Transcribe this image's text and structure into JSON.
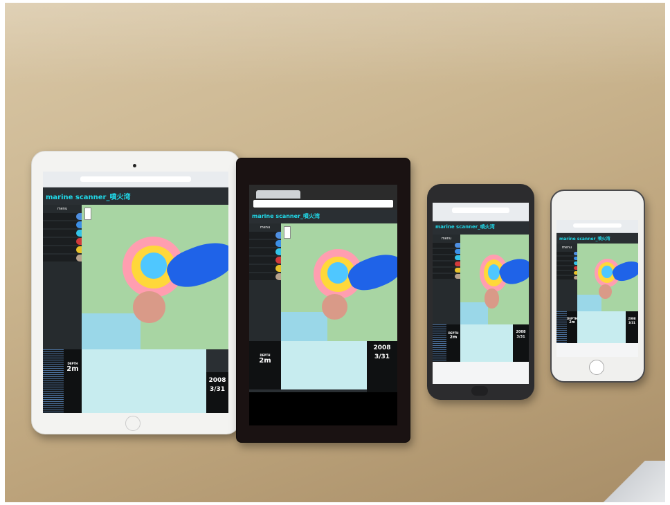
{
  "scene": {
    "description_colors": {
      "table": "#c8b38e",
      "app_accent": "#20d8e8"
    }
  },
  "app": {
    "title": "marine scanner_噴火湾",
    "sidebar_header": "menu",
    "layers": [
      {
        "label": "",
        "color": "#4f8fe0"
      },
      {
        "label": "",
        "color": "#3c8fe6"
      },
      {
        "label": "",
        "color": "#34c3e8"
      },
      {
        "label": "",
        "color": "#d23b3b"
      },
      {
        "label": "",
        "color": "#e8c22b"
      },
      {
        "label": "",
        "color": "#b7a28e"
      }
    ],
    "depth_label": "DEPTH",
    "depth_value": "2m",
    "year": "2008",
    "date": "3/31"
  }
}
